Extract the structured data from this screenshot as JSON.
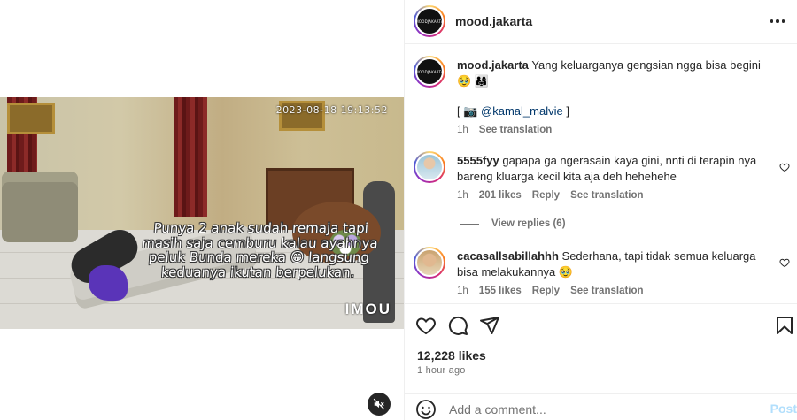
{
  "media": {
    "timestamp": "2023-08-18 19:13:52",
    "caption": "Punya 2 anak sudah remaja tapi masih saja cemburu kalau ayahnya peluk Bunda mereka 😁 langsung keduanya ikutan berpelukan.",
    "camera_logo": "IMOU",
    "mute_icon": "volume-muted-icon"
  },
  "header": {
    "username": "mood.jakarta",
    "avatar_text": "MOODJAKARTA",
    "more_icon": "more-horizontal-icon"
  },
  "post": {
    "username": "mood.jakarta",
    "text": "Yang keluarganya gengsian ngga bisa begini 🥹 👨‍👩‍👧",
    "credit_prefix": "[ 📷",
    "credit_handle": "@kamal_malvie",
    "credit_suffix": "]",
    "time": "1h",
    "see_translation": "See translation"
  },
  "comments": [
    {
      "username": "5555fyy",
      "text": "gapapa ga ngerasain kaya gini, nnti di terapin nya bareng kluarga kecil kita aja deh hehehehe",
      "time": "1h",
      "likes": "201 likes",
      "reply": "Reply",
      "see_translation": "See translation",
      "view_replies": "View replies (6)"
    },
    {
      "username": "cacasallsabillahhh",
      "text": "Sederhana, tapi tidak semua keluarga bisa melakukannya 🥹",
      "time": "1h",
      "likes": "155 likes",
      "reply": "Reply",
      "see_translation": "See translation"
    }
  ],
  "actions": {
    "like_icon": "heart-icon",
    "comment_icon": "comment-icon",
    "share_icon": "send-icon",
    "save_icon": "bookmark-icon",
    "likes": "12,228 likes",
    "time_ago": "1 hour ago"
  },
  "add_comment": {
    "placeholder": "Add a comment...",
    "post_label": "Post",
    "post_color": "#b2dffc"
  }
}
